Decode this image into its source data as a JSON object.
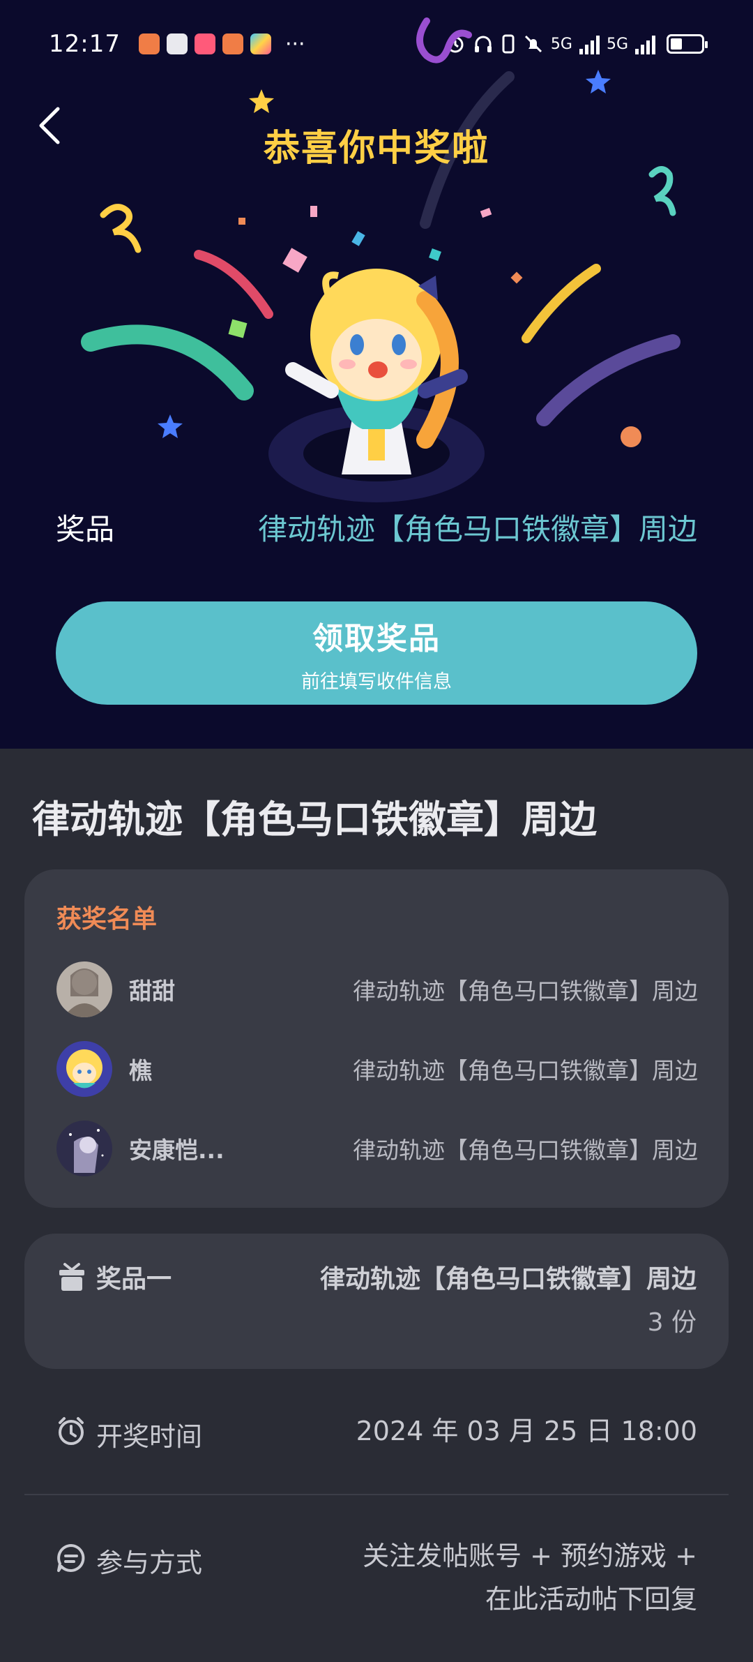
{
  "status_bar": {
    "time": "12:17",
    "more": "···",
    "network_1": "5G",
    "network_2": "5G"
  },
  "header": {
    "title": "恭喜你中奖啦"
  },
  "prize": {
    "label": "奖品",
    "value": "律动轨迹【角色马口铁徽章】周边"
  },
  "claim_button": {
    "title": "领取奖品",
    "subtitle": "前往填写收件信息"
  },
  "detail": {
    "title": "律动轨迹【角色马口铁徽章】周边"
  },
  "winners": {
    "heading": "获奖名单",
    "rows": [
      {
        "name": "甜甜",
        "prize": "律动轨迹【角色马口铁徽章】周边"
      },
      {
        "name": "樵",
        "prize": "律动轨迹【角色马口铁徽章】周边"
      },
      {
        "name": "安康恺...",
        "prize": "律动轨迹【角色马口铁徽章】周边"
      }
    ]
  },
  "prize_card": {
    "label": "奖品一",
    "value": "律动轨迹【角色马口铁徽章】周边",
    "count": "3 份"
  },
  "draw_time": {
    "label": "开奖时间",
    "value": "2024 年 03 月 25 日 18:00"
  },
  "participation": {
    "label": "参与方式",
    "line1": "关注发帖账号 + 预约游戏 +",
    "line2": "在此活动帖下回复"
  },
  "colors": {
    "hero_bg": "#0b0a2c",
    "page_bg": "#2a2c35",
    "card_bg": "#393b45",
    "accent_teal": "#5ac0cb",
    "title_yellow": "#ffcf45",
    "winners_orange": "#f08b56"
  },
  "icons": {
    "back": "chevron-left-icon",
    "gift": "gift-icon",
    "alarm": "alarm-clock-icon",
    "chat": "chat-bubble-icon"
  }
}
